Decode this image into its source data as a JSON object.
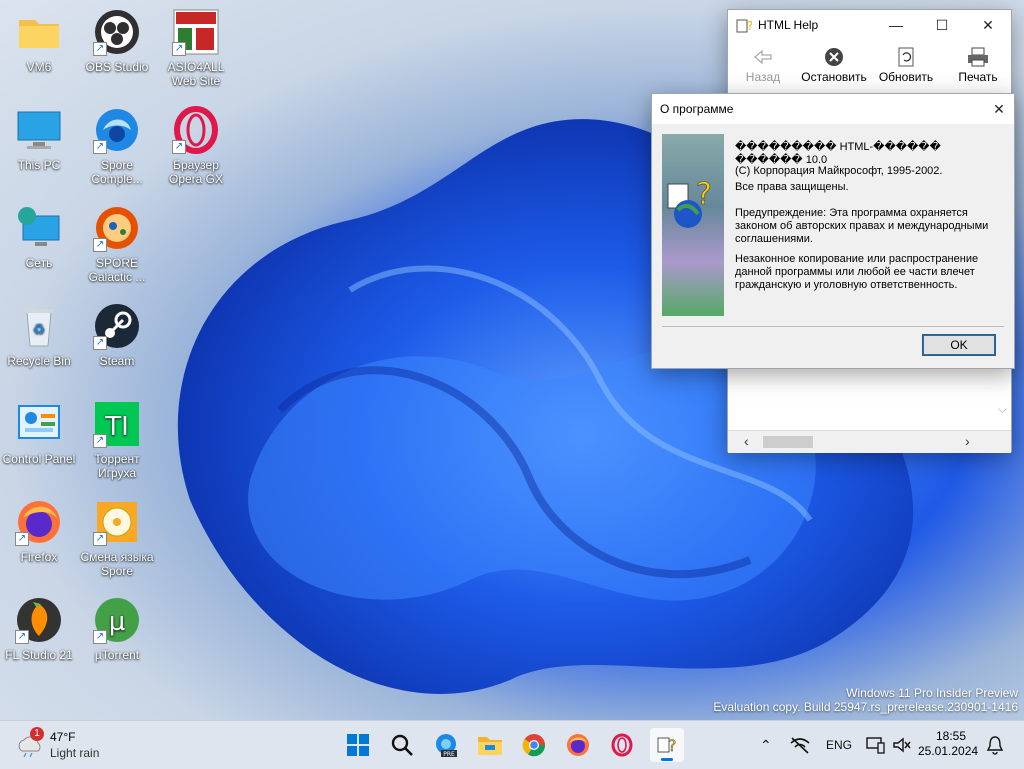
{
  "desktop_icons": [
    {
      "label": "VM6",
      "icon": "folder-icon"
    },
    {
      "label": "OBS Studio",
      "icon": "obs-icon"
    },
    {
      "label": "ASIO4ALL Web Site",
      "icon": "asio-icon"
    },
    {
      "label": "This PC",
      "icon": "monitor-icon"
    },
    {
      "label": "Spore Comple...",
      "icon": "spore-icon"
    },
    {
      "label": "Браузер Opera GX",
      "icon": "opera-icon"
    },
    {
      "label": "Сеть",
      "icon": "network-icon"
    },
    {
      "label": "SPORE Galactic ...",
      "icon": "spore-galactic-icon"
    },
    {
      "label": "Recycle Bin",
      "icon": "recycle-bin-icon"
    },
    {
      "label": "Steam",
      "icon": "steam-icon"
    },
    {
      "label": "Control Panel",
      "icon": "control-panel-icon"
    },
    {
      "label": "Торрент Игруха",
      "icon": "torrent-igruha-icon"
    },
    {
      "label": "Firefox",
      "icon": "firefox-icon"
    },
    {
      "label": "Смена языка Spore",
      "icon": "disc-icon"
    },
    {
      "label": "FL Studio 21",
      "icon": "fl-studio-icon"
    },
    {
      "label": "µTorrent",
      "icon": "utorrent-icon"
    }
  ],
  "html_help": {
    "title": "HTML Help",
    "toolbar": {
      "back": "Назад",
      "stop": "Остановить",
      "refresh": "Обновить",
      "print": "Печать"
    }
  },
  "about_dialog": {
    "title": "О программе",
    "product_line": "��������� HTML-������ ������ 10.0",
    "copyright": "(C) Корпорация Майкрософт, 1995-2002.",
    "rights": "Все права защищены.",
    "warning": "Предупреждение: Эта программа охраняется законом об авторских правах и международными соглашениями.",
    "illegal": "Незаконное копирование или распространение данной программы или любой ее части влечет гражданскую и уголовную ответственность.",
    "ok_label": "OK"
  },
  "watermark": {
    "line1": "Windows 11 Pro Insider Preview",
    "line2": "Evaluation copy. Build 25947.rs_prerelease.230901-1416"
  },
  "taskbar": {
    "weather_badge": "1",
    "temperature": "47°F",
    "condition": "Light rain",
    "language": "ENG",
    "time": "18:55",
    "date": "25.01.2024",
    "pinned": [
      "start-icon",
      "search-icon",
      "edge-pre-icon",
      "file-explorer-icon",
      "chrome-icon",
      "firefox-icon",
      "opera-icon",
      "html-help-icon"
    ]
  },
  "colors": {
    "accent": "#0078d4",
    "taskbar_bg": "#dfe5ee"
  }
}
